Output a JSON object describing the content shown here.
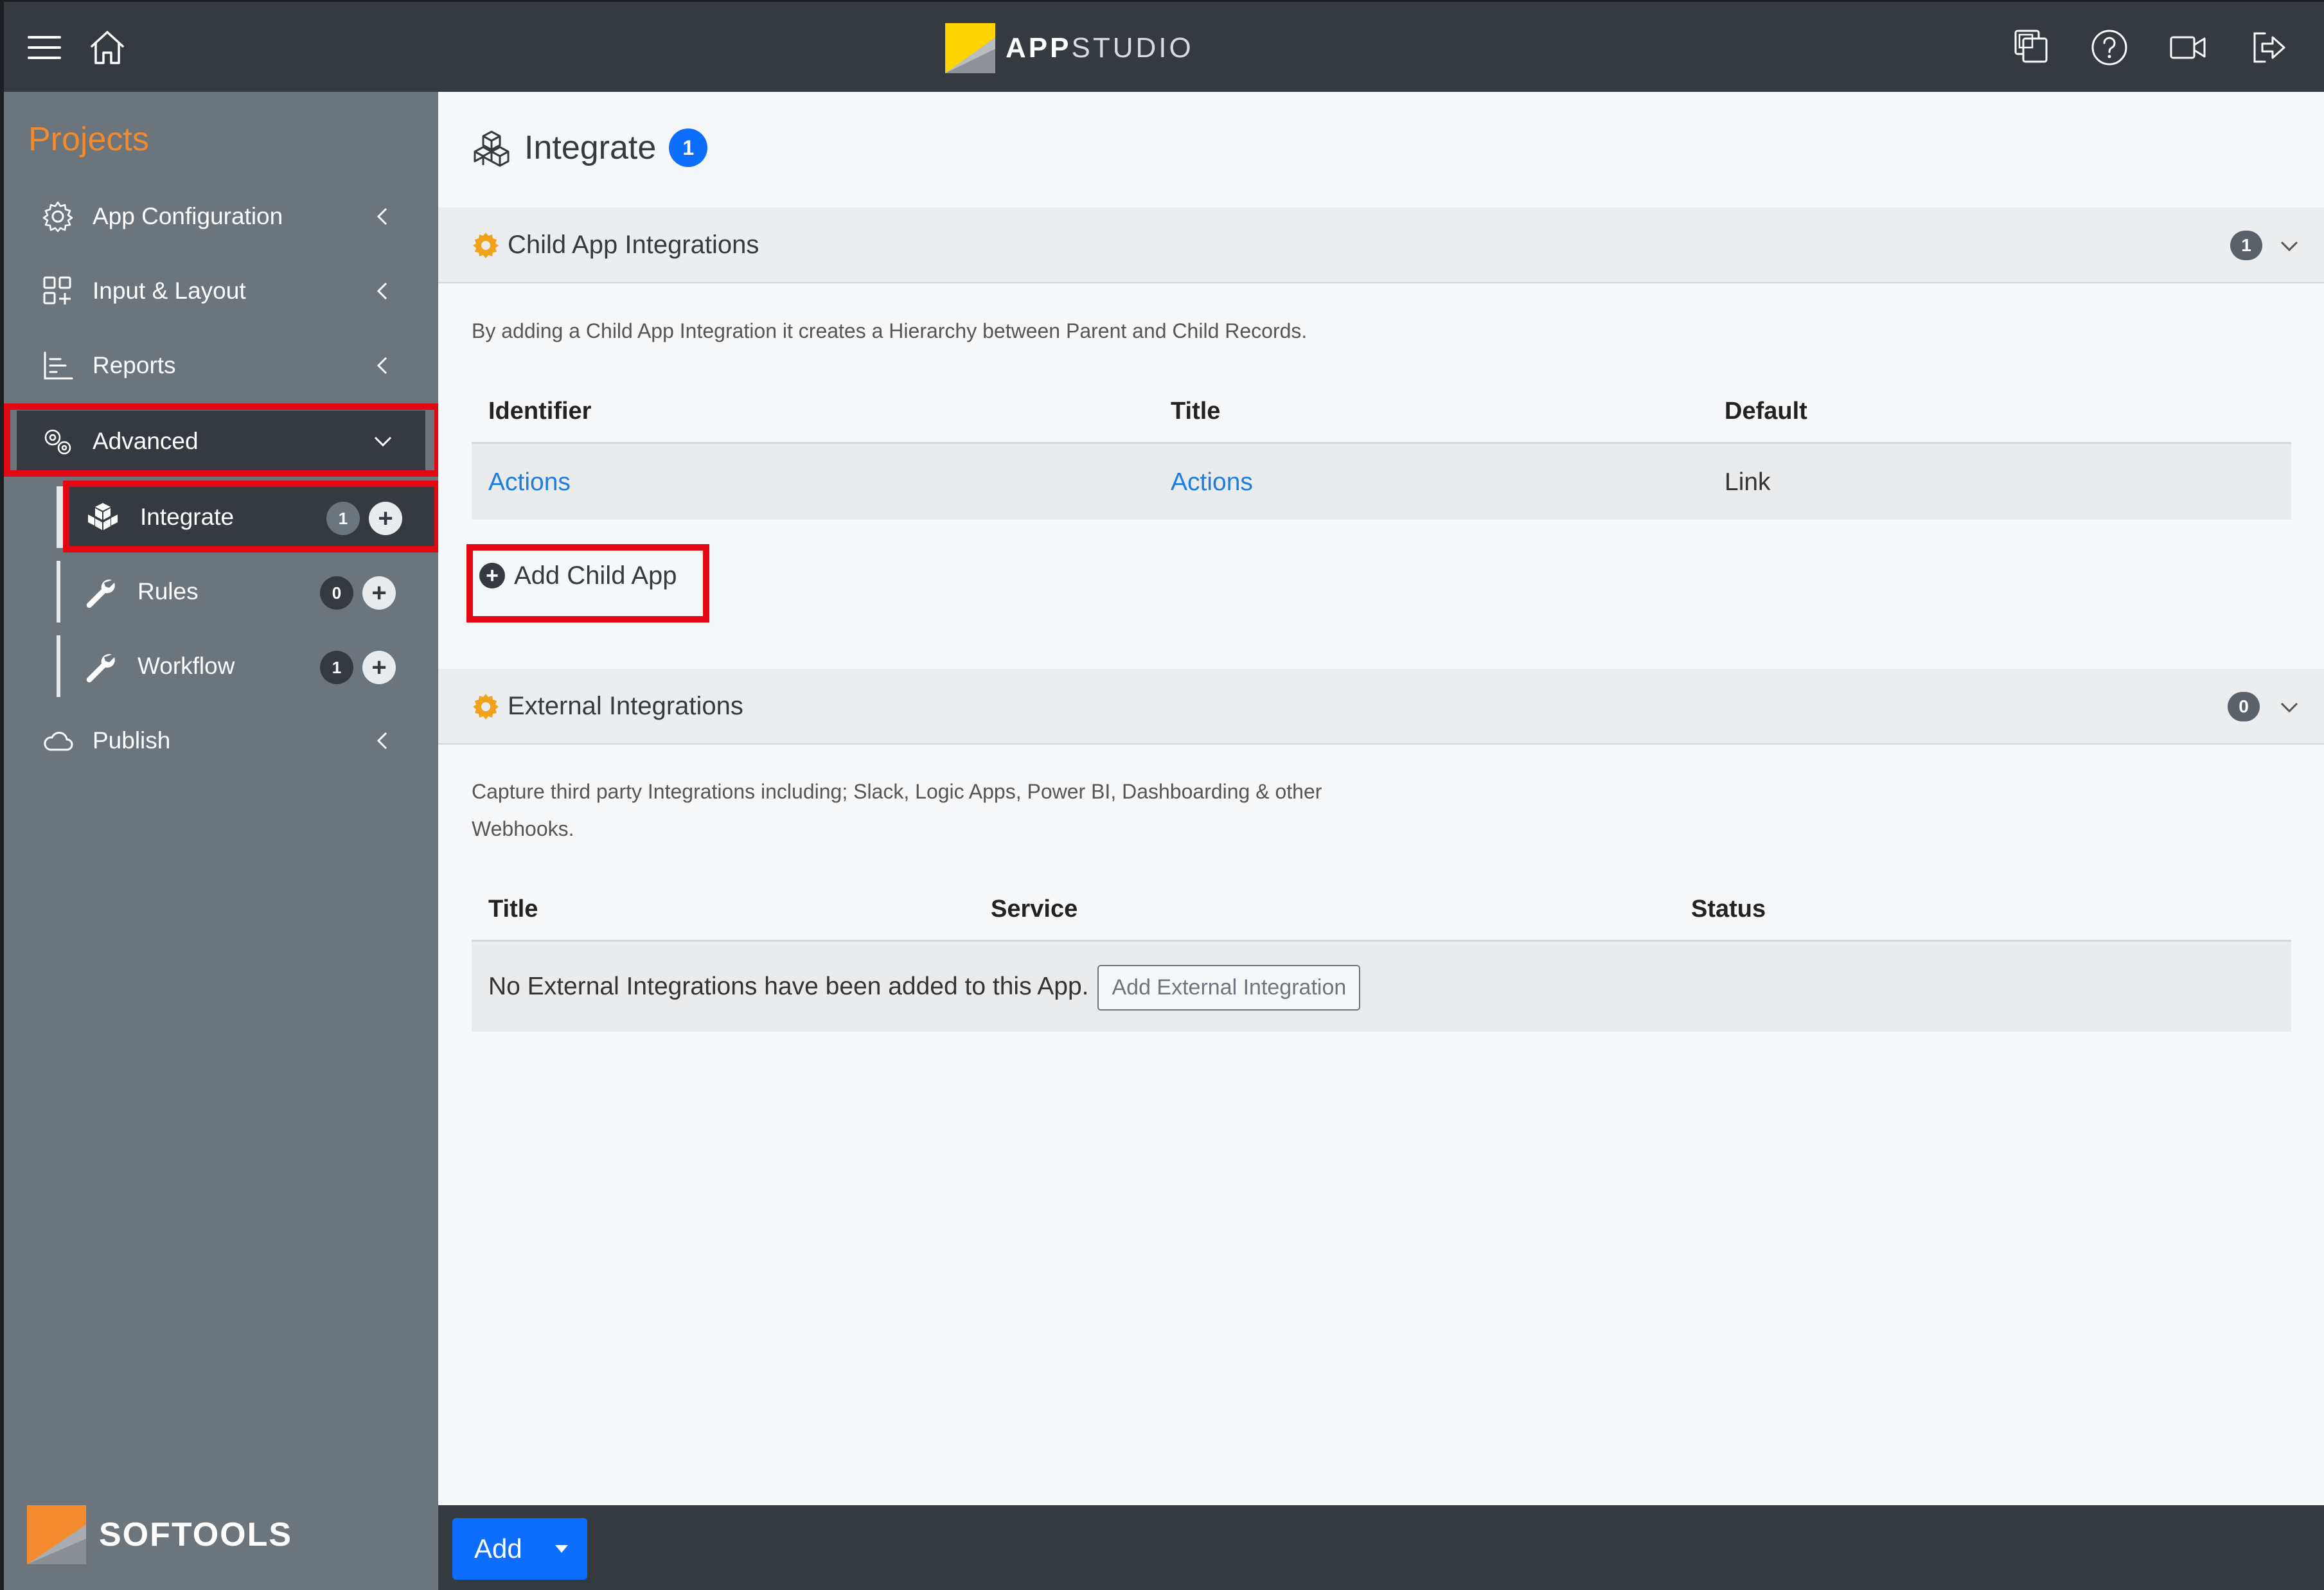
{
  "topbar": {
    "brand_bold": "APP",
    "brand_light": "STUDIO",
    "icons": [
      "menu-icon",
      "home-icon",
      "copy-icon",
      "help-icon",
      "video-icon",
      "logout-icon"
    ]
  },
  "sidebar": {
    "heading": "Projects",
    "items": [
      {
        "label": "App Configuration",
        "icon": "gear-icon"
      },
      {
        "label": "Input & Layout",
        "icon": "layout-icon"
      },
      {
        "label": "Reports",
        "icon": "chart-icon"
      },
      {
        "label": "Advanced",
        "icon": "gears-icon"
      },
      {
        "label": "Publish",
        "icon": "cloud-icon"
      }
    ],
    "sub_items": [
      {
        "label": "Integrate",
        "count": "1",
        "icon": "cubes-icon"
      },
      {
        "label": "Rules",
        "count": "0",
        "icon": "wrench-icon"
      },
      {
        "label": "Workflow",
        "count": "1",
        "icon": "wrench-icon"
      }
    ],
    "footer_brand": "SOFTOOLS"
  },
  "page": {
    "title": "Integrate",
    "badge": "1"
  },
  "child_section": {
    "title": "Child App Integrations",
    "count": "1",
    "description": "By adding a Child App Integration it creates a Hierarchy between Parent and Child Records.",
    "columns": [
      "Identifier",
      "Title",
      "Default"
    ],
    "rows": [
      {
        "identifier": "Actions",
        "title": "Actions",
        "default": "Link"
      }
    ],
    "add_label": "Add Child App"
  },
  "external_section": {
    "title": "External Integrations",
    "count": "0",
    "description_line1": "Capture third party Integrations including; Slack, Logic Apps, Power BI, Dashboarding & other",
    "description_line2": "Webhooks.",
    "columns": [
      "Title",
      "Service",
      "Status"
    ],
    "empty_text": "No External Integrations have been added to this App.",
    "add_button": "Add External Integration"
  },
  "bottombar": {
    "add_label": "Add"
  },
  "colors": {
    "topbar": "#343a40",
    "sidebar": "#6c747c",
    "accent_orange": "#f28a2e",
    "primary_blue": "#0d6efd",
    "highlight_red": "#e30613",
    "link_blue": "#1f7de0"
  }
}
